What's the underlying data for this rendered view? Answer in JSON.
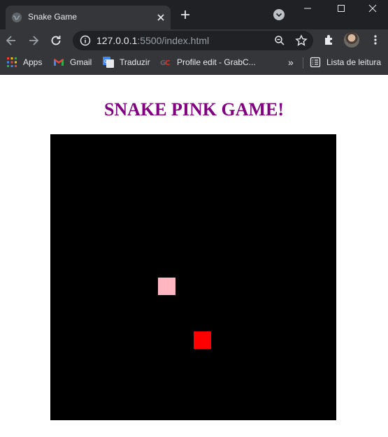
{
  "browser": {
    "tab": {
      "title": "Snake Game"
    },
    "address": {
      "host": "127.0.0.1",
      "rest": ":5500/index.html"
    },
    "bookmarks": [
      {
        "label": "Apps"
      },
      {
        "label": "Gmail"
      },
      {
        "label": "Traduzir"
      },
      {
        "label": "Profile edit - GrabC..."
      },
      {
        "label": "»"
      },
      {
        "label": "Lista de leitura"
      }
    ]
  },
  "page": {
    "title": "SNAKE PINK GAME!"
  },
  "game": {
    "grid_size": 16,
    "snake": [
      {
        "col": 6,
        "row": 8
      }
    ],
    "food": {
      "col": 8,
      "row": 11
    },
    "colors": {
      "board": "#000000",
      "snake": "#ffb6c1",
      "food": "#ff0000",
      "title": "#800080"
    }
  }
}
